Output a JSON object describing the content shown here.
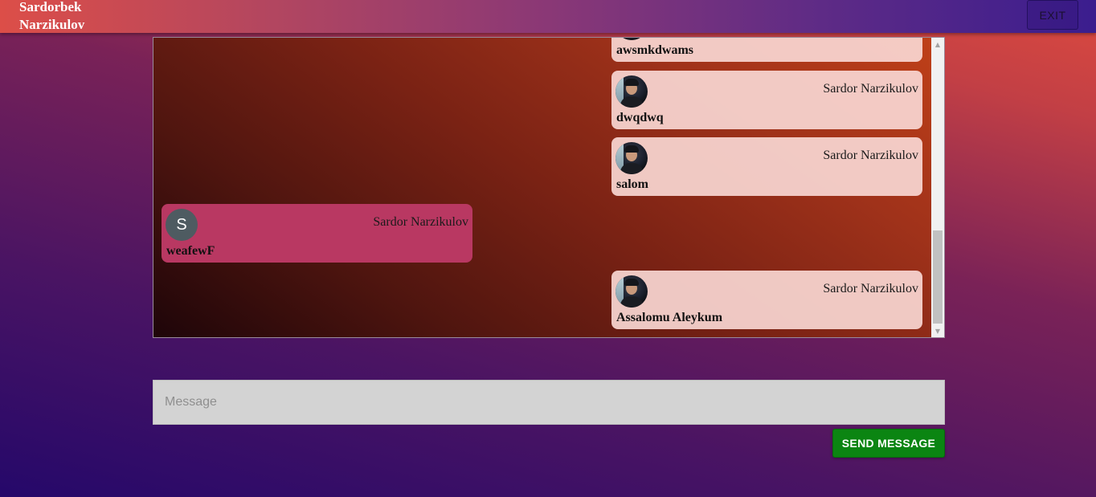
{
  "header": {
    "brand_line1": "Sardorbek",
    "brand_line2": "Narzikulov",
    "exit_label": "EXIT"
  },
  "chat": {
    "messages": [
      {
        "sender": "",
        "text": "awsmkdwams",
        "side": "right",
        "avatar": "photo"
      },
      {
        "sender": "Sardor Narzikulov",
        "text": "dwqdwq",
        "side": "right",
        "avatar": "photo"
      },
      {
        "sender": "Sardor Narzikulov",
        "text": "salom",
        "side": "right",
        "avatar": "photo"
      },
      {
        "sender": "Sardor Narzikulov",
        "text": "weafewF",
        "side": "left",
        "avatar": "S"
      },
      {
        "sender": "Sardor Narzikulov",
        "text": "Assalomu Aleykum",
        "side": "right",
        "avatar": "photo"
      }
    ]
  },
  "composer": {
    "placeholder": "Message",
    "value": "",
    "send_label": "SEND MESSAGE"
  },
  "colors": {
    "send_button": "#0b8512",
    "other_bubble": "#b93862",
    "own_bubble": "#f8d7d2"
  }
}
